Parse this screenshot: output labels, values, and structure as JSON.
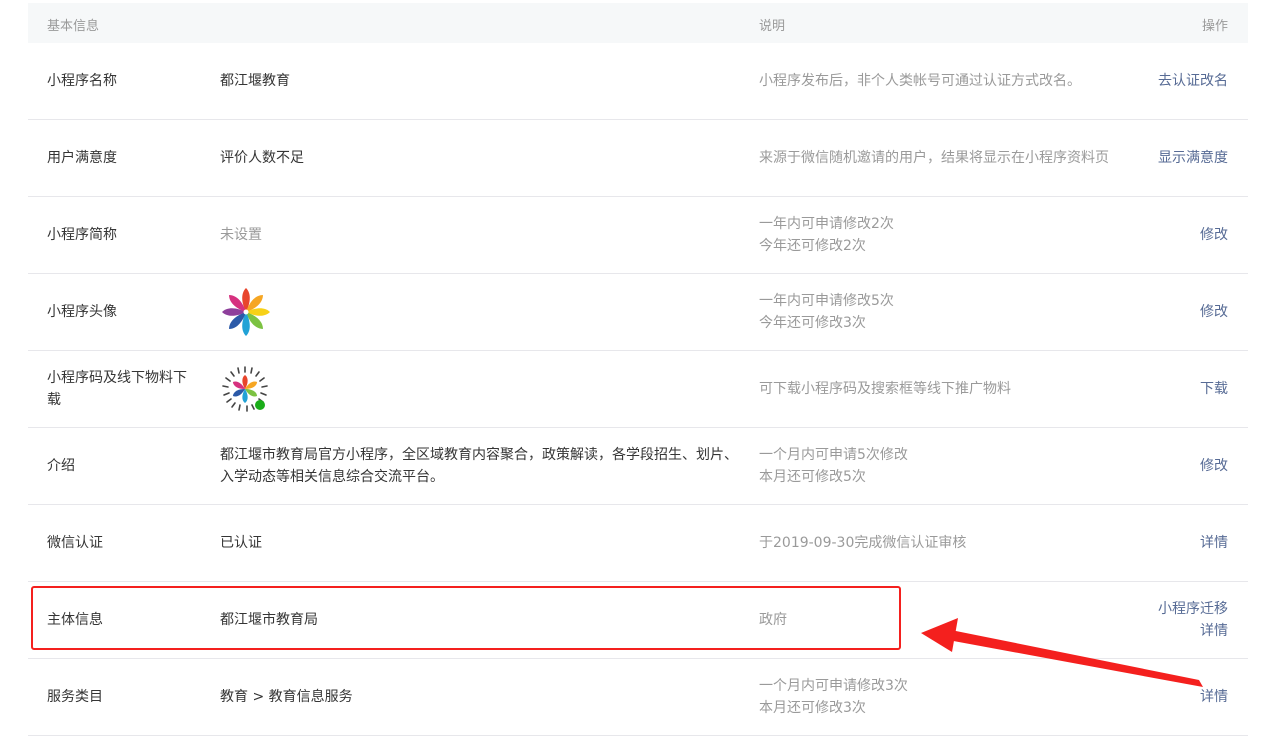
{
  "header": {
    "basic": "基本信息",
    "desc": "说明",
    "op": "操作"
  },
  "rows": [
    {
      "label": "小程序名称",
      "value": "都江堰教育",
      "desc": [
        "小程序发布后，非个人类帐号可通过认证方式改名。"
      ],
      "ops": [
        "去认证改名"
      ]
    },
    {
      "label": "用户满意度",
      "value": "评价人数不足",
      "desc": [
        "来源于微信随机邀请的用户，结果将显示在小程序资料页"
      ],
      "ops": [
        "显示满意度"
      ]
    },
    {
      "label": "小程序简称",
      "value": "未设置",
      "desc": [
        "一年内可申请修改2次",
        "今年还可修改2次"
      ],
      "ops": [
        "修改"
      ]
    },
    {
      "label": "小程序头像",
      "value_icon": "avatar-pinwheel-icon",
      "desc": [
        "一年内可申请修改5次",
        "今年还可修改3次"
      ],
      "ops": [
        "修改"
      ]
    },
    {
      "label": "小程序码及线下物料下载",
      "value_icon": "mini-program-code-icon",
      "desc": [
        "可下载小程序码及搜索框等线下推广物料"
      ],
      "ops": [
        "下载"
      ]
    },
    {
      "label": "介绍",
      "value": "都江堰市教育局官方小程序，全区域教育内容聚合，政策解读，各学段招生、划片、入学动态等相关信息综合交流平台。",
      "desc": [
        "一个月内可申请5次修改",
        "本月还可修改5次"
      ],
      "ops": [
        "修改"
      ]
    },
    {
      "label": "微信认证",
      "value": "已认证",
      "desc": [
        "于2019-09-30完成微信认证审核"
      ],
      "ops": [
        "详情"
      ]
    },
    {
      "label": "主体信息",
      "value": "都江堰市教育局",
      "desc": [
        "政府"
      ],
      "ops": [
        "小程序迁移",
        "详情"
      ]
    },
    {
      "label": "服务类目",
      "value": "教育 > 教育信息服务",
      "desc": [
        "一个月内可申请修改3次",
        "本月还可修改3次"
      ],
      "ops": [
        "详情"
      ]
    }
  ],
  "colors": {
    "link": "#576b95",
    "muted": "#9a9a9a",
    "highlight": "#f4201e",
    "header_bg": "#f6f8f9"
  }
}
